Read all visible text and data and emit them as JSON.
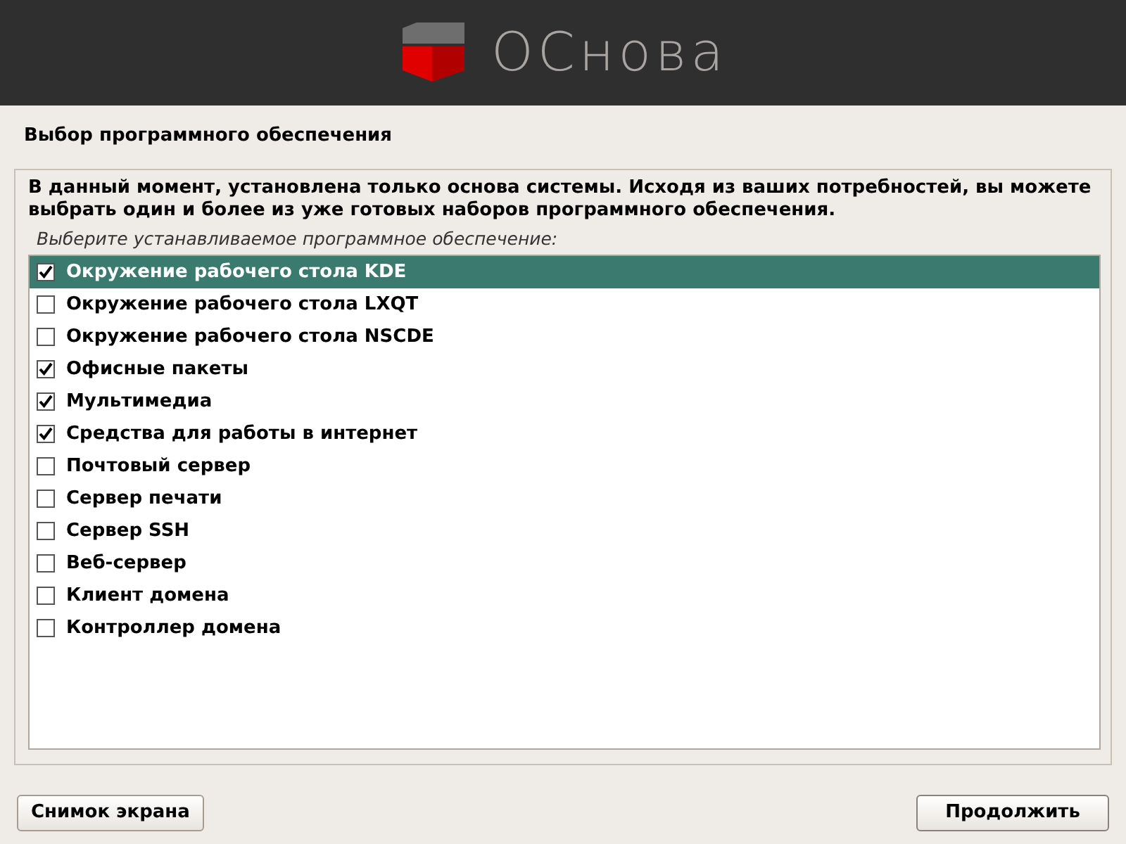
{
  "header": {
    "logo_text": "ОСнова"
  },
  "page_title": "Выбор программного обеспечения",
  "description": "В данный момент, установлена только основа системы. Исходя из ваших потребностей, вы можете выбрать один и более из уже готовых наборов программного обеспечения.",
  "prompt": "Выберите устанавливаемое программное обеспечение:",
  "items": [
    {
      "label": "Окружение рабочего стола KDE",
      "checked": true,
      "selected": true
    },
    {
      "label": "Окружение рабочего стола LXQT",
      "checked": false,
      "selected": false
    },
    {
      "label": "Окружение рабочего стола NSCDE",
      "checked": false,
      "selected": false
    },
    {
      "label": "Офисные пакеты",
      "checked": true,
      "selected": false
    },
    {
      "label": "Мультимедиа",
      "checked": true,
      "selected": false
    },
    {
      "label": "Средства для работы в интернет",
      "checked": true,
      "selected": false
    },
    {
      "label": "Почтовый сервер",
      "checked": false,
      "selected": false
    },
    {
      "label": "Сервер печати",
      "checked": false,
      "selected": false
    },
    {
      "label": "Сервер SSH",
      "checked": false,
      "selected": false
    },
    {
      "label": "Веб-сервер",
      "checked": false,
      "selected": false
    },
    {
      "label": "Клиент домена",
      "checked": false,
      "selected": false
    },
    {
      "label": "Контроллер домена",
      "checked": false,
      "selected": false
    }
  ],
  "buttons": {
    "left": "Снимок экрана",
    "right": "Продолжить"
  }
}
